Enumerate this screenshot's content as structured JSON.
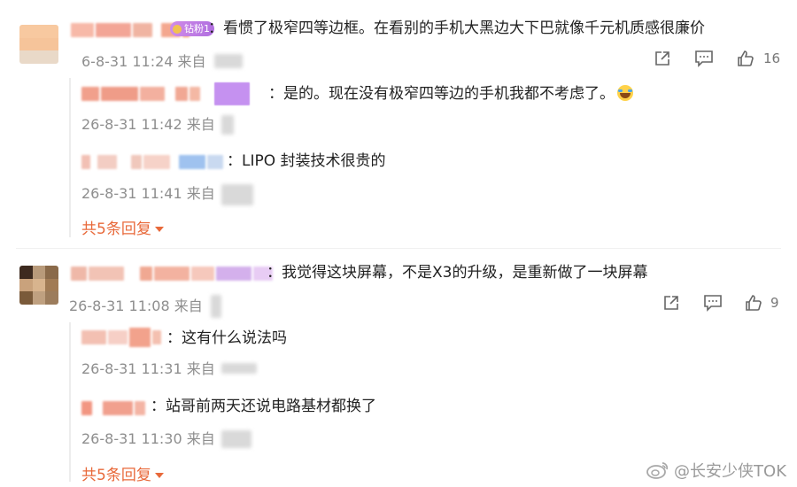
{
  "comments": [
    {
      "badge": "钻粉1",
      "text": "：看惯了极窄四等边框。在看别的手机大黑边大下巴就像千元机质感很廉价",
      "time": "6-8-31 11:24 来自",
      "likes": "16",
      "replies": [
        {
          "text": "：是的。现在没有极窄四等边的手机我都不考虑了。",
          "time": "26-8-31 11:42 来自"
        },
        {
          "text": "：LIPO 封装技术很贵的",
          "time": "26-8-31 11:41 来自"
        }
      ],
      "more": "共5条回复"
    },
    {
      "text": "：我觉得这块屏幕，不是X3的升级，是重新做了一块屏幕",
      "time": "26-8-31 11:08 来自",
      "likes": "9",
      "replies": [
        {
          "text": "：这有什么说法吗",
          "time": "26-8-31 11:31 来自"
        },
        {
          "text": "：站哥前两天还说电路基材都换了",
          "time": "26-8-31 11:30 来自"
        }
      ],
      "more": "共5条回复"
    }
  ],
  "watermark": "@长安少侠TOK",
  "icons": {
    "share": "share-icon",
    "comment": "comment-icon",
    "like": "thumbs-up-icon",
    "weibo": "weibo-logo-icon",
    "emoji": "laughing-emoji-icon"
  },
  "colors": {
    "accent": "#e8693a",
    "meta": "#8e8e8e",
    "text": "#222222"
  }
}
